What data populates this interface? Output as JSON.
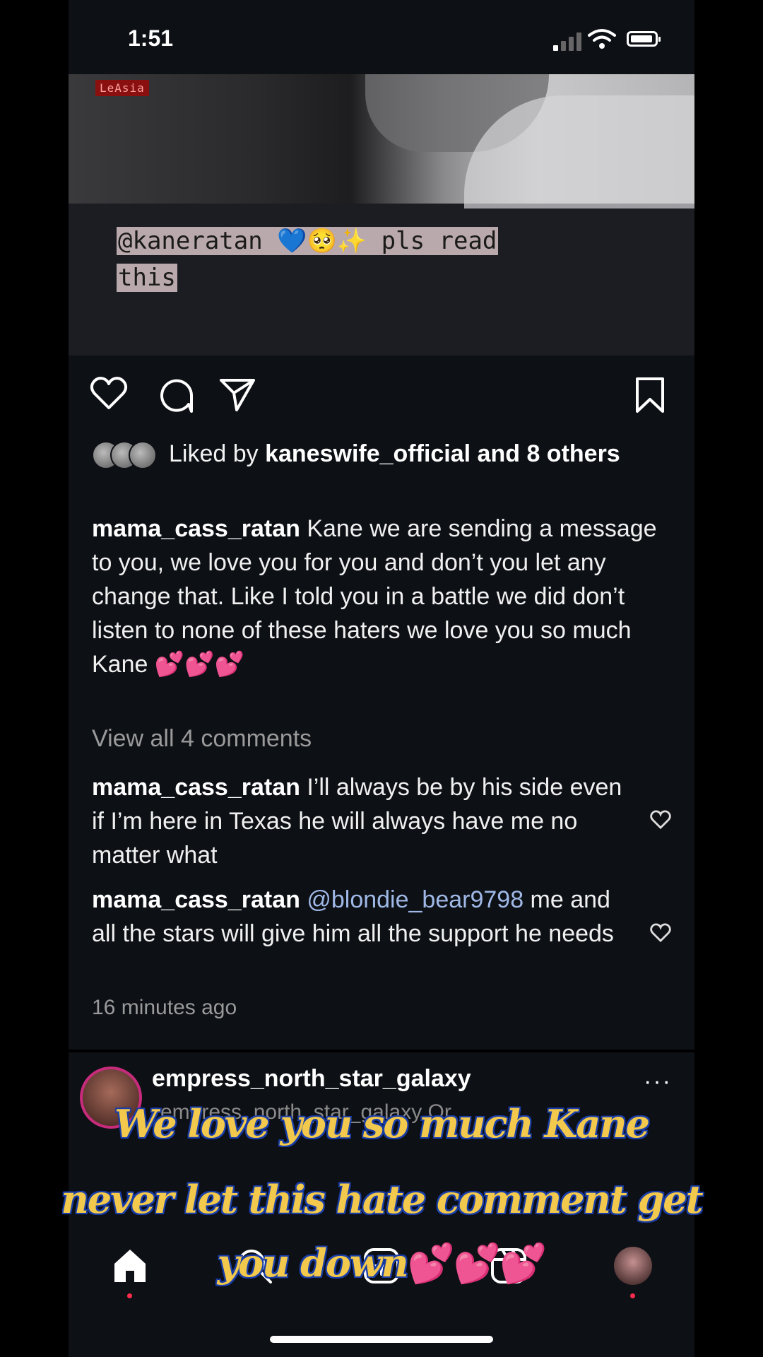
{
  "status": {
    "time": "1:51"
  },
  "post": {
    "image_label": "LeAsia",
    "image_caption_line1": "@kaneratan 💙🥺✨ pls read",
    "image_caption_line2": "this",
    "likes": {
      "prefix": "Liked by ",
      "user": "kaneswife_official",
      "suffix": " and 8 others"
    },
    "caption": {
      "user": "mama_cass_ratan",
      "text": " Kane we are sending a message to you, we love you for you and don’t you let any change that. Like I told you in a battle we did don’t listen to none of these haters we love you so much Kane 💕💕💕"
    },
    "view_all": "View all 4 comments",
    "comments": [
      {
        "user": "mama_cass_ratan",
        "text": " I’ll always be by his side even if I’m here in Texas he will always have me no matter what"
      },
      {
        "user": "mama_cass_ratan",
        "mention": " @blondie_bear9798",
        "text": " me and all the stars will give him all the support he needs"
      }
    ],
    "time_ago": "16 minutes ago"
  },
  "next_post": {
    "user": "empress_north_star_galaxy",
    "subtext": "empress_north_star_galaxy Or",
    "more": "···"
  },
  "overlay": {
    "line1": "We love you so much Kane",
    "line2": "never let this hate comment get",
    "line3": "you down",
    "hearts": "💕💕💕"
  },
  "icons": [
    "heart-icon",
    "comment-icon",
    "share-icon",
    "bookmark-icon",
    "home-icon",
    "search-icon",
    "create-icon",
    "reels-icon",
    "profile-icon"
  ],
  "colors": {
    "background": "#0d1015",
    "mention": "#9fb8e6",
    "overlay_text": "#f2c94c",
    "overlay_outline": "#1b3fa8"
  }
}
